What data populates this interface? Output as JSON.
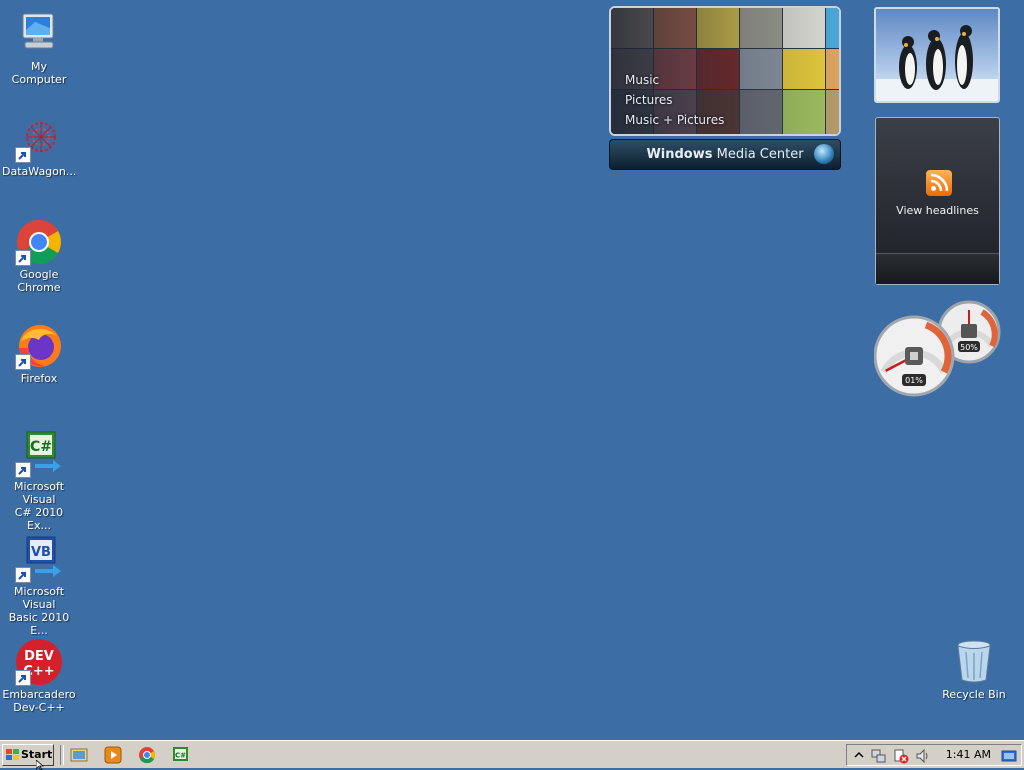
{
  "desktop_icons": [
    {
      "label": "My Computer"
    },
    {
      "label": "DataWagon..."
    },
    {
      "label": "Google Chrome"
    },
    {
      "label": "Firefox"
    },
    {
      "label_line1": "Microsoft Visual",
      "label_line2": "C# 2010 Ex..."
    },
    {
      "label_line1": "Microsoft Visual",
      "label_line2": "Basic 2010 E..."
    },
    {
      "label_line1": "Embarcadero",
      "label_line2": "Dev-C++"
    },
    {
      "label": "Recycle Bin"
    }
  ],
  "media_center": {
    "menu": [
      "Music",
      "Pictures",
      "Music + Pictures"
    ],
    "brand_bold": "Windows",
    "brand_rest": " Media Center"
  },
  "feeds": {
    "label": "View headlines"
  },
  "cpu_meter": {
    "cpu_label": "01%",
    "memory_label": "50%",
    "cpu_value": 1,
    "memory_value": 50
  },
  "taskbar": {
    "start_label": "Start",
    "clock": "1:41 AM"
  },
  "colors": {
    "desktop": "#3c6ea5",
    "taskbar": "#d4d0c8",
    "feed_accent": "#f06a00"
  }
}
